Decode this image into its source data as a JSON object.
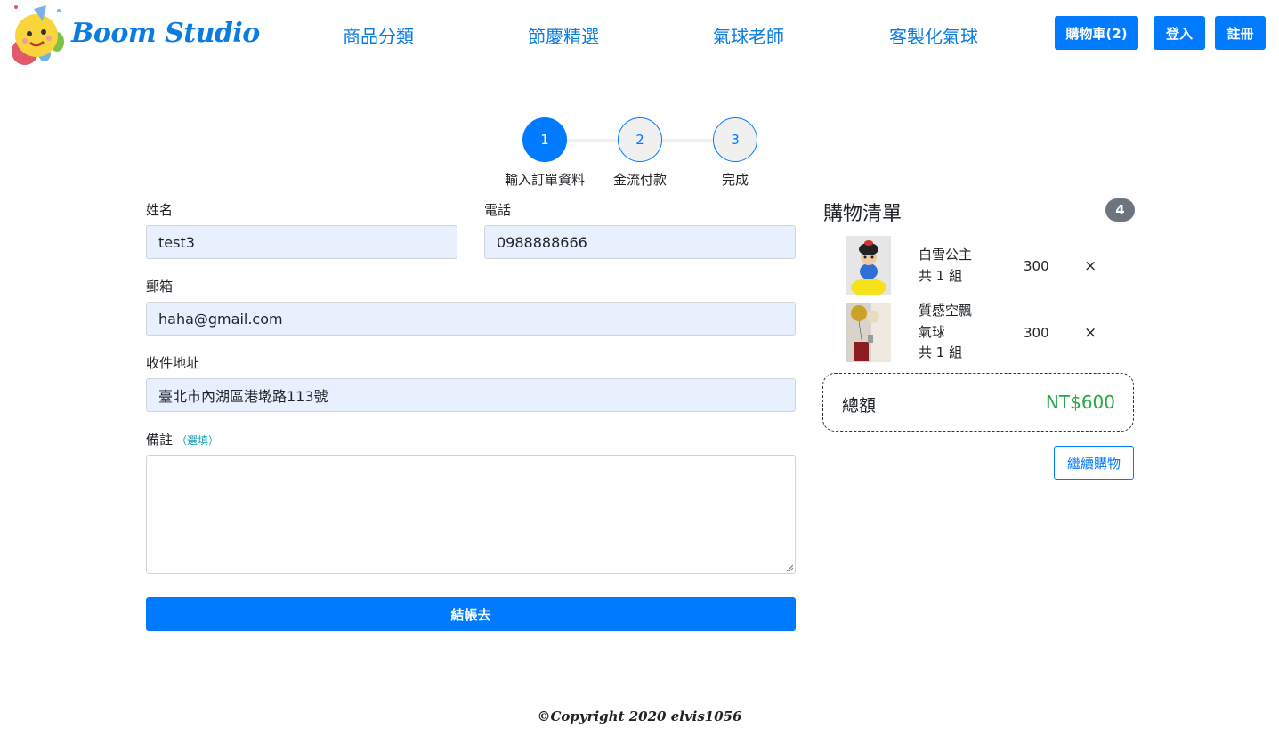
{
  "brand": {
    "name": "Boom Studio",
    "logo": "smiling-balloon-logo"
  },
  "nav": {
    "items": [
      {
        "label": "商品分類"
      },
      {
        "label": "節慶精選"
      },
      {
        "label": "氣球老師"
      },
      {
        "label": "客製化氣球"
      }
    ],
    "cart_button": "購物車(2)",
    "login_button": "登入",
    "register_button": "註冊"
  },
  "stepper": {
    "current": 1,
    "steps": [
      {
        "number": "1",
        "label": "輸入訂單資料"
      },
      {
        "number": "2",
        "label": "金流付款"
      },
      {
        "number": "3",
        "label": "完成"
      }
    ]
  },
  "form": {
    "name": {
      "label": "姓名",
      "value": "test3"
    },
    "phone": {
      "label": "電話",
      "value": "0988888666"
    },
    "email": {
      "label": "郵箱",
      "value": "haha@gmail.com"
    },
    "address": {
      "label": "收件地址",
      "value": "臺北市內湖區港墘路113號"
    },
    "note": {
      "label": "備註",
      "optional": "（選填）",
      "value": ""
    },
    "submit_label": "結帳去"
  },
  "cart": {
    "title": "購物清單",
    "count": "4",
    "items": [
      {
        "name_lines": [
          "白雪公主",
          "共 1 組"
        ],
        "price": "300",
        "remove": "×",
        "thumb": "snow-white-balloon"
      },
      {
        "name_lines": [
          "質感空飄",
          "氣球",
          "共 1 組"
        ],
        "price": "300",
        "remove": "×",
        "thumb": "floating-gold-balloon"
      }
    ],
    "total_label": "總額",
    "total_value": "NT$600",
    "continue_label": "繼續購物"
  },
  "footer": {
    "copyright": "©Copyright 2020 elvis1056"
  },
  "colors": {
    "primary": "#007bff",
    "link": "#0a7be0",
    "success": "#28a745",
    "badge": "#6c757d",
    "input_autofill": "#e8f0fe"
  }
}
